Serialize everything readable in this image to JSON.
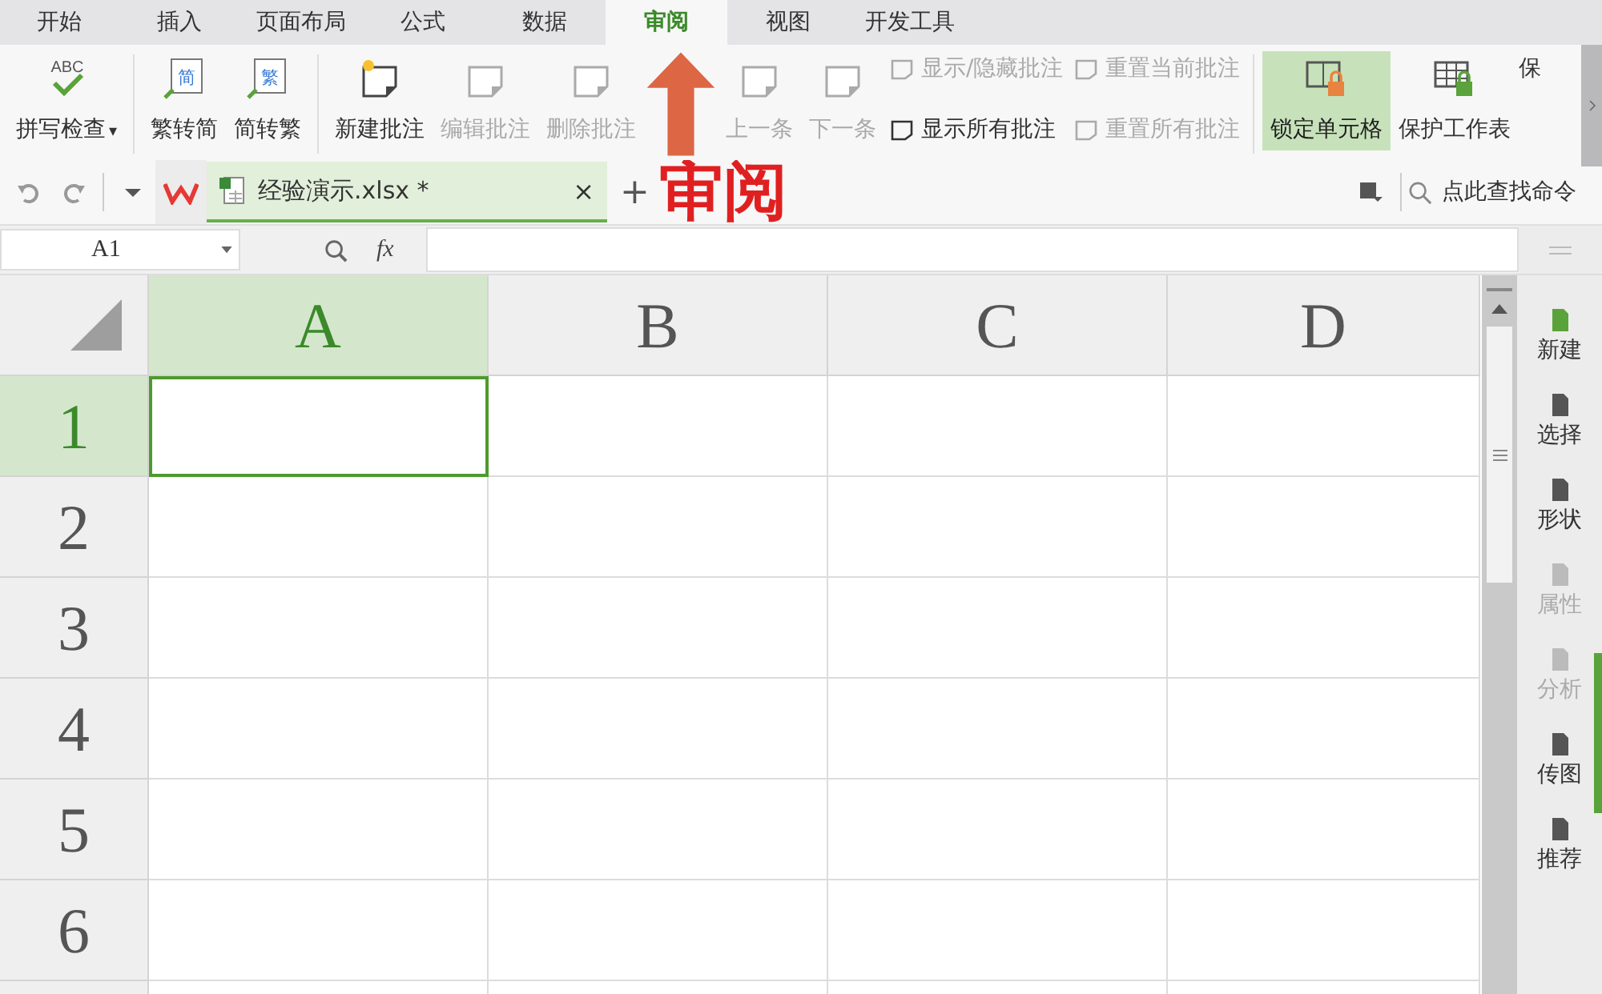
{
  "menu_tabs": [
    {
      "label": "开始",
      "selected": false
    },
    {
      "label": "插入",
      "selected": false
    },
    {
      "label": "页面布局",
      "selected": false
    },
    {
      "label": "公式",
      "selected": false
    },
    {
      "label": "数据",
      "selected": false
    },
    {
      "label": "审阅",
      "selected": true
    },
    {
      "label": "视图",
      "selected": false
    },
    {
      "label": "开发工具",
      "selected": false
    }
  ],
  "ribbon": {
    "groups": [
      {
        "items": [
          {
            "kind": "spell",
            "label": "拼写检查",
            "icon_text": "ABC",
            "caret": "▾",
            "disabled": false,
            "selected": false
          }
        ]
      },
      {
        "items": [
          {
            "kind": "convert",
            "label": "繁转简",
            "icon_text": "简",
            "disabled": false,
            "selected": false
          },
          {
            "kind": "convert",
            "label": "简转繁",
            "icon_text": "繁",
            "disabled": false,
            "selected": false
          }
        ]
      },
      {
        "items": [
          {
            "kind": "big",
            "label": "新建批注",
            "disabled": false,
            "selected": false
          },
          {
            "kind": "big",
            "label": "编辑批注",
            "disabled": true,
            "selected": false
          },
          {
            "kind": "big",
            "label": "删除批注",
            "disabled": true,
            "selected": false
          },
          {
            "kind": "big",
            "label": "上一条",
            "disabled": true,
            "selected": false
          },
          {
            "kind": "big",
            "label": "下一条",
            "disabled": true,
            "selected": false
          },
          {
            "kind": "small",
            "label": "显示/隐藏批注",
            "disabled": true,
            "selected": false
          },
          {
            "kind": "small",
            "label": "显示所有批注",
            "disabled": false,
            "selected": false
          },
          {
            "kind": "small",
            "label": "重置当前批注",
            "disabled": true,
            "selected": false
          },
          {
            "kind": "small",
            "label": "重置所有批注",
            "disabled": true,
            "selected": false
          }
        ]
      },
      {
        "items": [
          {
            "kind": "lock",
            "label": "锁定单元格",
            "disabled": false,
            "selected": true
          },
          {
            "kind": "protect",
            "label": "保护工作表",
            "disabled": false,
            "selected": false
          },
          {
            "kind": "cut",
            "label": "保",
            "disabled": false,
            "selected": false
          }
        ]
      }
    ]
  },
  "document_tab": {
    "title": "经验演示.xlsx *",
    "close": "×",
    "add": "+"
  },
  "command_search": {
    "placeholder": "点此查找命令"
  },
  "name_box": {
    "value": "A1"
  },
  "formula_label": "fx",
  "sheet": {
    "columns": [
      {
        "label": "A",
        "selected": true
      },
      {
        "label": "B",
        "selected": false
      },
      {
        "label": "C",
        "selected": false
      },
      {
        "label": "D",
        "selected": false
      }
    ],
    "rows": [
      {
        "label": "1",
        "selected": true
      },
      {
        "label": "2",
        "selected": false
      },
      {
        "label": "3",
        "selected": false
      },
      {
        "label": "4",
        "selected": false
      },
      {
        "label": "5",
        "selected": false
      },
      {
        "label": "6",
        "selected": false
      }
    ]
  },
  "side_panel": [
    {
      "label": "新建",
      "disabled": false
    },
    {
      "label": "选择",
      "disabled": false
    },
    {
      "label": "形状",
      "disabled": false
    },
    {
      "label": "属性",
      "disabled": true
    },
    {
      "label": "分析",
      "disabled": true
    },
    {
      "label": "传图",
      "disabled": false
    },
    {
      "label": "推荐",
      "disabled": false
    }
  ],
  "annotation": {
    "text": "审阅"
  }
}
